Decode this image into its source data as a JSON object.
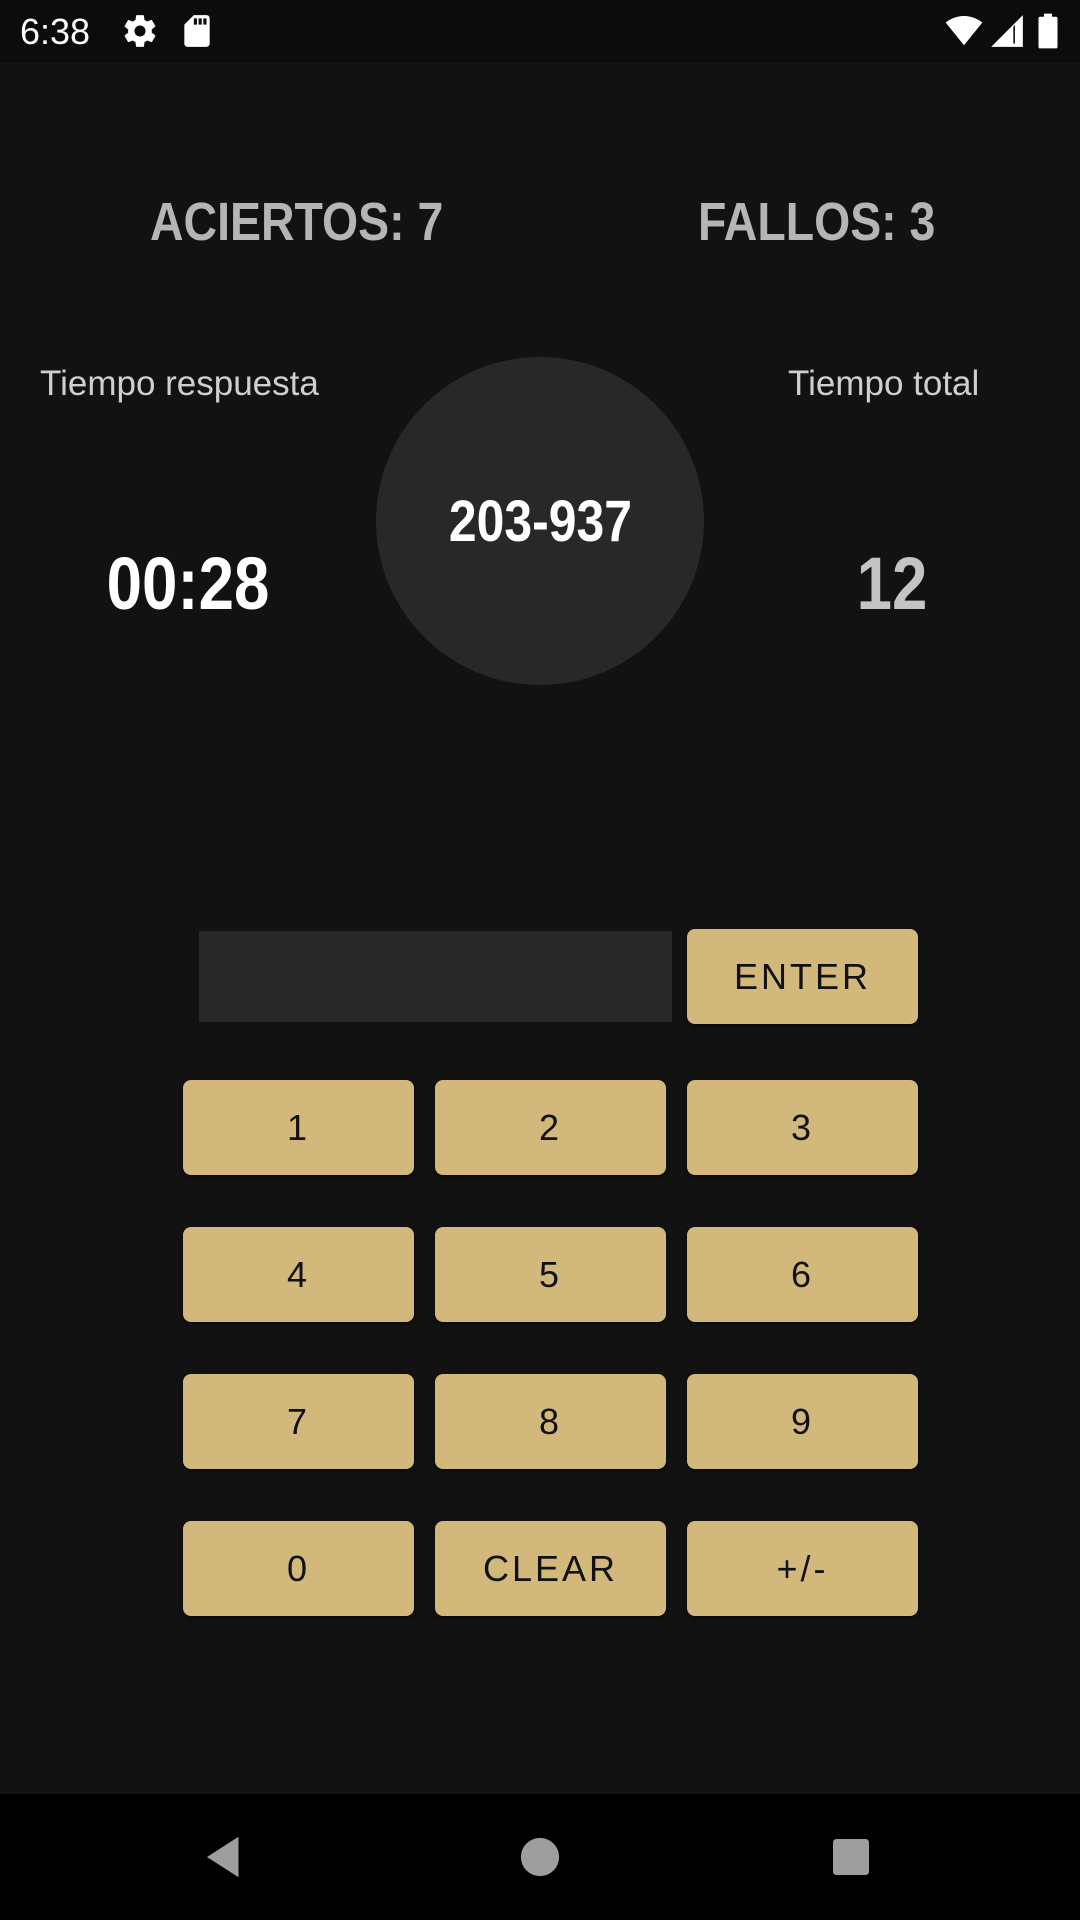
{
  "status_bar": {
    "time": "6:38",
    "icons": [
      "settings-icon",
      "sd-card-icon",
      "wifi-icon",
      "signal-icon",
      "battery-icon"
    ]
  },
  "score": {
    "hits_label": "ACIERTOS: 7",
    "fails_label": "FALLOS: 3"
  },
  "timers": {
    "response_label": "Tiempo respuesta",
    "response_value": "00:28",
    "total_label": "Tiempo total",
    "total_value": "12"
  },
  "problem": {
    "expression": "203-937"
  },
  "answer": {
    "value": "",
    "placeholder": ""
  },
  "keypad": {
    "enter": "ENTER",
    "keys": [
      "1",
      "2",
      "3",
      "4",
      "5",
      "6",
      "7",
      "8",
      "9",
      "0",
      "CLEAR",
      "+/-"
    ]
  },
  "nav_bar": {
    "icons": [
      "back-icon",
      "home-icon",
      "recents-icon"
    ]
  },
  "colors": {
    "background": "#121212",
    "button": "#d3b87b",
    "panel": "#282828"
  }
}
